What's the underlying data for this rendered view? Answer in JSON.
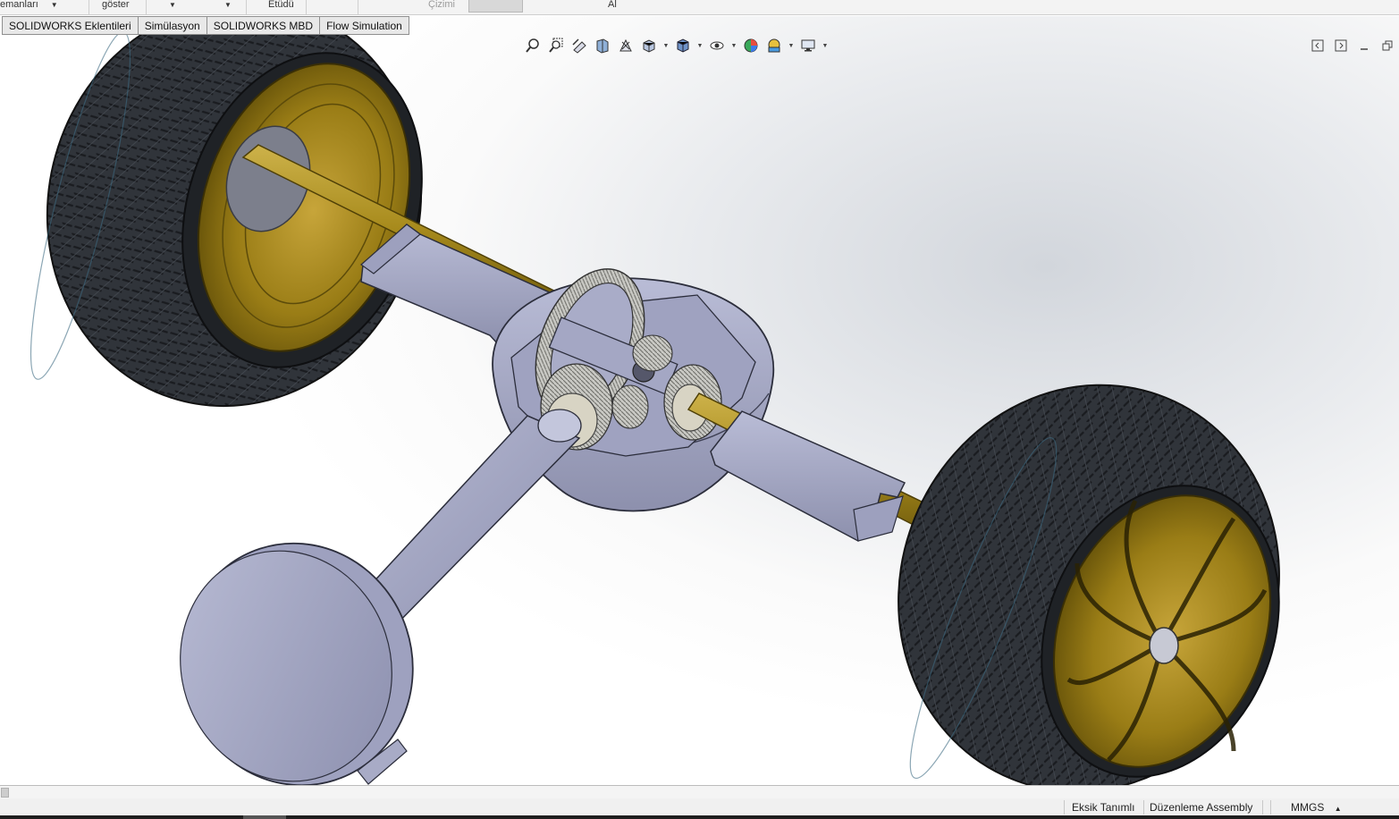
{
  "ribbon": {
    "items": [
      {
        "label": "emanları",
        "caret": true
      },
      {
        "label": "göster",
        "caret": false
      },
      {
        "label": "",
        "caret": true
      },
      {
        "label": "",
        "caret": true
      },
      {
        "label": "Etüdü",
        "caret": false
      },
      {
        "label": "Çizimi",
        "caret": false
      },
      {
        "label": "Al",
        "caret": false
      }
    ]
  },
  "tabs": [
    {
      "label": "SOLIDWORKS Eklentileri"
    },
    {
      "label": "Simülasyon"
    },
    {
      "label": "SOLIDWORKS MBD"
    },
    {
      "label": "Flow Simulation"
    }
  ],
  "view_toolbar": {
    "buttons": [
      "zoom-to-fit-icon",
      "zoom-to-area-icon",
      "previous-view-icon",
      "section-view-icon",
      "dynamic-annotation-views-icon",
      "view-orientation-icon",
      "display-style-icon",
      "hide-show-items-icon",
      "edit-appearance-icon",
      "apply-scene-icon",
      "view-settings-icon"
    ]
  },
  "status_bar": {
    "definition": "Eksik Tanımlı",
    "mode": "Düzenleme Assembly",
    "units": "MMGS",
    "units_caret": "▲"
  },
  "colors": {
    "tire": "#2c2f33",
    "rim": "#c9a227",
    "shaft_gold": "#a88b1e",
    "housing": "#a8acc8",
    "background_top": "#d2d6dc"
  }
}
